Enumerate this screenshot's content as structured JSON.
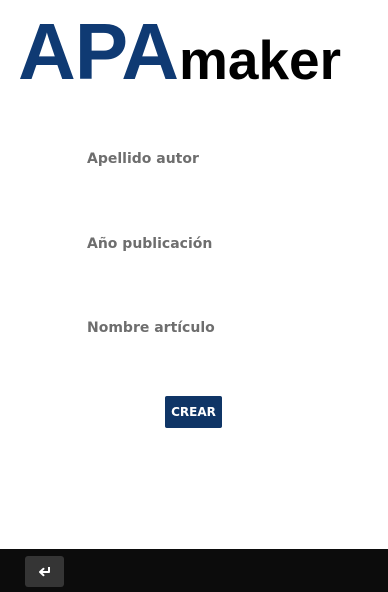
{
  "logo": {
    "apa": "APA",
    "maker": "maker",
    "apa_color": "#0f3a73",
    "maker_color": "#000000"
  },
  "form": {
    "fields": [
      {
        "label": "Apellido autor",
        "value": "",
        "placeholder": ""
      },
      {
        "label": "Año publicación",
        "value": "",
        "placeholder": ""
      },
      {
        "label": "Nombre artículo",
        "value": "",
        "placeholder": ""
      }
    ],
    "submit_label": "CREAR",
    "submit_color": "#0f3566"
  },
  "navbar": {
    "background": "#0c0c0c",
    "back_icon": "return-arrow-icon"
  }
}
